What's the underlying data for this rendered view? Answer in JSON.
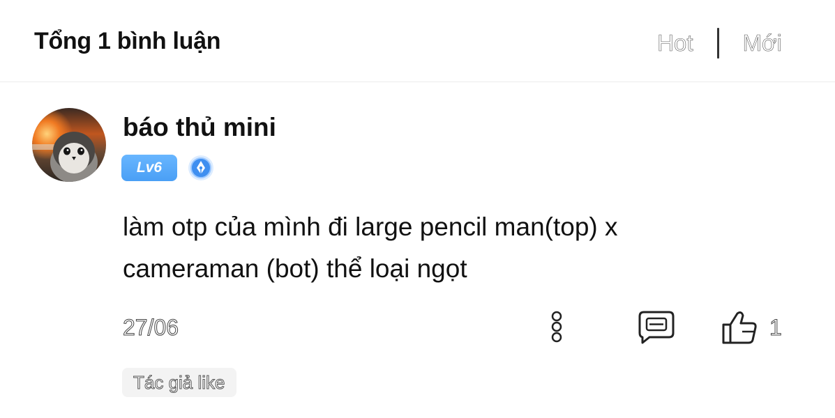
{
  "header": {
    "total_label": "Tổng 1 bình luận",
    "sort_hot": "Hot",
    "sort_new": "Mới"
  },
  "comment": {
    "username": "báo thủ mini",
    "level_badge": "Lv6",
    "text_line1": "làm otp của mình đi large pencil man(top) x",
    "text_line2": "cameraman (bot) thể loại ngọt",
    "date": "27/06",
    "like_count": "1",
    "author_like_tag": "Tác giả like",
    "icons": {
      "avatar": "penguin-avatar",
      "medal": "pen-medal-icon",
      "more": "more-vertical-icon",
      "reply": "reply-comment-icon",
      "like": "thumbs-up-icon"
    }
  },
  "colors": {
    "level_badge": "#4a9ff5",
    "text": "#111111",
    "muted": "#444444",
    "tag_bg": "#f3f3f3"
  }
}
